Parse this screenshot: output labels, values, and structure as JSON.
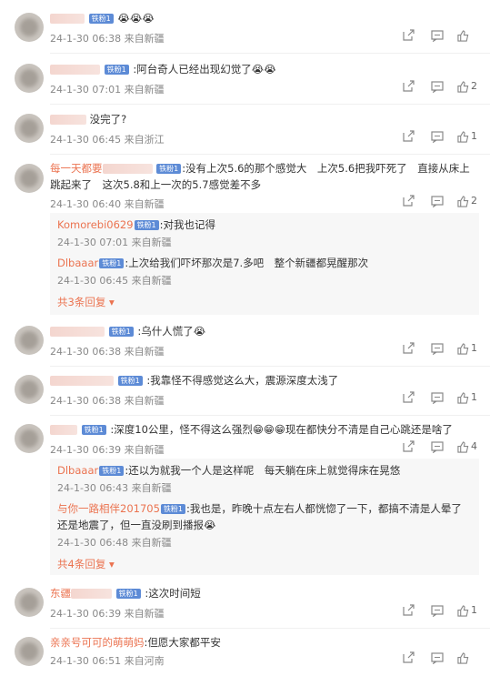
{
  "badge_text": "铁粉1",
  "comments": [
    {
      "text": "😭😭😭",
      "meta": "24-1-30 06:38 来自新疆",
      "likes": ""
    },
    {
      "text": ":阿台奇人已经出现幻觉了😭😭",
      "meta": "24-1-30 07:01 来自新疆",
      "likes": "2"
    },
    {
      "text": "没完了?",
      "meta": "24-1-30 06:45 来自浙江",
      "likes": "1"
    },
    {
      "name": "每一天都要",
      "text": ":没有上次5.6的那个感觉大　上次5.6把我吓死了　直接从床上跳起来了　这次5.8和上一次的5.7感觉差不多",
      "meta": "24-1-30 06:40 来自新疆",
      "likes": "2"
    },
    {
      "text": ":乌什人慌了😭",
      "meta": "24-1-30 06:38 来自新疆",
      "likes": "1"
    },
    {
      "text": ":我靠怪不得感觉这么大，震源深度太浅了",
      "meta": "24-1-30 06:38 来自新疆",
      "likes": "1"
    },
    {
      "text": ":深度10公里，怪不得这么强烈😁😁😁现在都快分不清是自己心跳还是啥了",
      "meta": "24-1-30 06:39 来自新疆",
      "likes": "4"
    },
    {
      "name": "东疆",
      "text": ":这次时间短",
      "meta": "24-1-30 06:39 来自新疆",
      "likes": "1"
    },
    {
      "name": "亲亲号可可的萌萌妈",
      "text": ":但愿大家都平安",
      "meta": "24-1-30 06:51 来自河南",
      "likes": ""
    }
  ],
  "replies_a": [
    {
      "name": "Komorebi0629",
      "text": ":对我也记得",
      "meta": "24-1-30 07:01 来自新疆"
    },
    {
      "name": "Dlbaaar",
      "text": ":上次给我们吓坏那次是7.多吧　整个新疆都晃醒那次",
      "meta": "24-1-30 06:45 来自新疆"
    }
  ],
  "more_a": "共3条回复",
  "replies_b": [
    {
      "name": "Dlbaaar",
      "text": ":还以为就我一个人是这样呢　每天躺在床上就觉得床在晃悠",
      "meta": "24-1-30 06:43 来自新疆"
    },
    {
      "name": "与你一路相伴201705",
      "text": ":我也是，昨晚十点左右人都恍惚了一下，都搞不清是人晕了还是地震了，但一直没刷到播报😭",
      "meta": "24-1-30 06:48 来自新疆"
    }
  ],
  "more_b": "共4条回复",
  "colors": {
    "accent": "#eb7350",
    "badge": "#5d8bd6",
    "meta": "#888888"
  }
}
